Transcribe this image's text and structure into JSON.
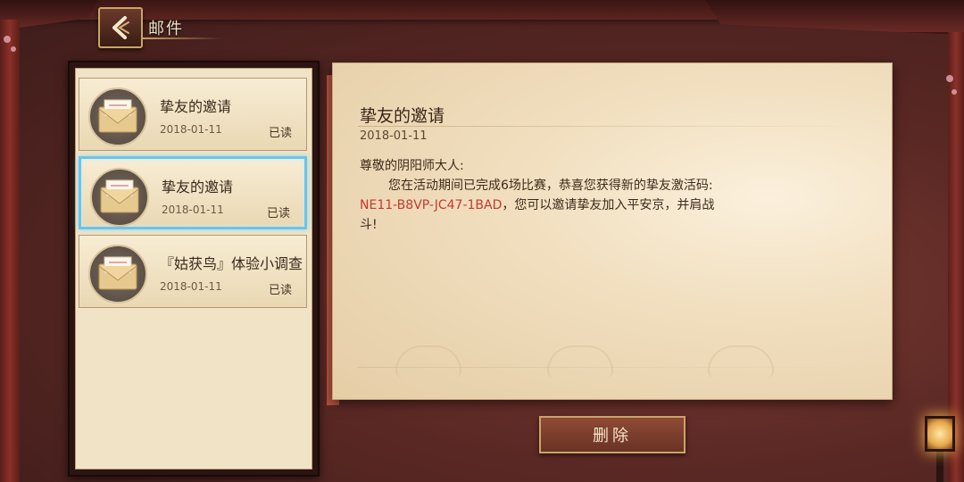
{
  "header": {
    "title": "邮件"
  },
  "mails": [
    {
      "title": "挚友的邀请",
      "date": "2018-01-11",
      "status": "已读",
      "selected": false
    },
    {
      "title": "挚友的邀请",
      "date": "2018-01-11",
      "status": "已读",
      "selected": true
    },
    {
      "title": "『姑获鸟』体验小调查",
      "date": "2018-01-11",
      "status": "已读",
      "selected": false
    }
  ],
  "letter": {
    "title": "挚友的邀请",
    "date": "2018-01-11",
    "greeting": "尊敬的阴阳师大人:",
    "line1": "您在活动期间已完成6场比赛，恭喜您获得新的挚友激活码:",
    "code": "NE11-B8VP-JC47-1BAD",
    "line2": "，您可以邀请挚友加入平安京，并肩战",
    "line3": "斗!"
  },
  "actions": {
    "delete_label": "删除"
  },
  "colors": {
    "accent_gold": "#c9a467",
    "selection_blue": "#6cc4e8",
    "code_red": "#c63a2f"
  }
}
